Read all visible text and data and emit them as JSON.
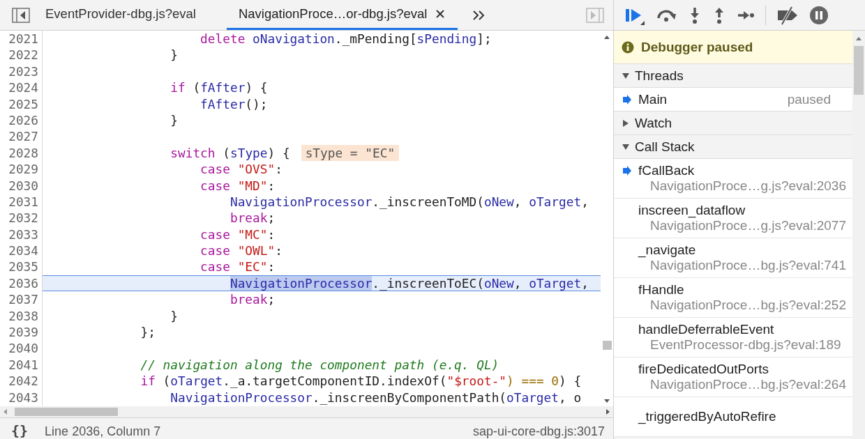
{
  "tabs": [
    {
      "label": "EventProvider-dbg.js?eval",
      "selected": false,
      "closable": false
    },
    {
      "label": "NavigationProce…or-dbg.js?eval",
      "selected": true,
      "closable": true
    }
  ],
  "code": {
    "lines": [
      {
        "number": "2021",
        "current": false,
        "tokens": [
          {
            "kind": "keyword",
            "text": "                    delete"
          },
          {
            "kind": "variable",
            "text": " oNavigation"
          },
          {
            "kind": "plain",
            "text": "._mPending["
          },
          {
            "kind": "variable",
            "text": "sPending"
          },
          {
            "kind": "plain",
            "text": "];"
          }
        ]
      },
      {
        "number": "2022",
        "current": false,
        "tokens": [
          {
            "kind": "plain",
            "text": "                }"
          }
        ]
      },
      {
        "number": "2023",
        "current": false
      },
      {
        "number": "2024",
        "current": false,
        "tokens": [
          {
            "kind": "keyword",
            "text": "                if"
          },
          {
            "kind": "plain",
            "text": " ("
          },
          {
            "kind": "variable",
            "text": "fAfter"
          },
          {
            "kind": "plain",
            "text": ") {"
          }
        ]
      },
      {
        "number": "2025",
        "current": false,
        "tokens": [
          {
            "kind": "variable",
            "text": "                    fAfter"
          },
          {
            "kind": "plain",
            "text": "();"
          }
        ]
      },
      {
        "number": "2026",
        "current": false,
        "tokens": [
          {
            "kind": "plain",
            "text": "                }"
          }
        ]
      },
      {
        "number": "2027",
        "current": false
      },
      {
        "number": "2028",
        "current": false,
        "tokens": [
          {
            "kind": "keyword",
            "text": "                switch"
          },
          {
            "kind": "plain",
            "text": " ("
          },
          {
            "kind": "variable",
            "text": "sType"
          },
          {
            "kind": "plain",
            "text": ") {"
          }
        ],
        "inline_value": "sType = \"EC\""
      },
      {
        "number": "2029",
        "current": false,
        "tokens": [
          {
            "kind": "keyword",
            "text": "                    case"
          },
          {
            "kind": "string",
            "text": " \"OVS\""
          },
          {
            "kind": "plain",
            "text": ":"
          }
        ]
      },
      {
        "number": "2030",
        "current": false,
        "tokens": [
          {
            "kind": "keyword",
            "text": "                    case"
          },
          {
            "kind": "string",
            "text": " \"MD\""
          },
          {
            "kind": "plain",
            "text": ":"
          }
        ]
      },
      {
        "number": "2031",
        "current": false,
        "tokens": [
          {
            "kind": "variable",
            "text": "                        NavigationProcessor"
          },
          {
            "kind": "plain",
            "text": "._inscreenToMD("
          },
          {
            "kind": "variable",
            "text": "oNew"
          },
          {
            "kind": "plain",
            "text": ", "
          },
          {
            "kind": "variable",
            "text": "oTarget"
          },
          {
            "kind": "plain",
            "text": ","
          }
        ]
      },
      {
        "number": "2032",
        "current": false,
        "tokens": [
          {
            "kind": "keyword",
            "text": "                        break"
          },
          {
            "kind": "plain",
            "text": ";"
          }
        ]
      },
      {
        "number": "2033",
        "current": false,
        "tokens": [
          {
            "kind": "keyword",
            "text": "                    case"
          },
          {
            "kind": "string",
            "text": " \"MC\""
          },
          {
            "kind": "plain",
            "text": ":"
          }
        ]
      },
      {
        "number": "2034",
        "current": false,
        "tokens": [
          {
            "kind": "keyword",
            "text": "                    case"
          },
          {
            "kind": "string",
            "text": " \"OWL\""
          },
          {
            "kind": "plain",
            "text": ":"
          }
        ]
      },
      {
        "number": "2035",
        "current": false,
        "tokens": [
          {
            "kind": "keyword",
            "text": "                    case"
          },
          {
            "kind": "string",
            "text": " \"EC\""
          },
          {
            "kind": "plain",
            "text": ":"
          }
        ]
      },
      {
        "number": "2036",
        "current": true,
        "tokens": [
          {
            "kind": "variable",
            "text": "                        NavigationProcessor",
            "selected": true
          },
          {
            "kind": "plain",
            "text": "._inscreenToEC("
          },
          {
            "kind": "variable",
            "text": "oNew"
          },
          {
            "kind": "plain",
            "text": ", "
          },
          {
            "kind": "variable",
            "text": "oTarget"
          },
          {
            "kind": "plain",
            "text": ","
          }
        ]
      },
      {
        "number": "2037",
        "current": false,
        "tokens": [
          {
            "kind": "keyword",
            "text": "                        break"
          },
          {
            "kind": "plain",
            "text": ";"
          }
        ]
      },
      {
        "number": "2038",
        "current": false,
        "tokens": [
          {
            "kind": "plain",
            "text": "                }"
          }
        ]
      },
      {
        "number": "2039",
        "current": false,
        "tokens": [
          {
            "kind": "plain",
            "text": "            };"
          }
        ]
      },
      {
        "number": "2040",
        "current": false
      },
      {
        "number": "2041",
        "current": false,
        "tokens": [
          {
            "kind": "comment",
            "text": "            // navigation along the component path (e.q. QL)"
          }
        ]
      },
      {
        "number": "2042",
        "current": false,
        "tokens": [
          {
            "kind": "keyword",
            "text": "            if"
          },
          {
            "kind": "plain",
            "text": " ("
          },
          {
            "kind": "variable",
            "text": "oTarget"
          },
          {
            "kind": "plain",
            "text": "._a.targetComponentID.indexOf("
          },
          {
            "kind": "string",
            "text": "\"$root-\""
          },
          {
            "kind": "operator",
            "text": ") ==="
          },
          {
            "kind": "number",
            "text": " 0"
          },
          {
            "kind": "plain",
            "text": ") {"
          }
        ]
      },
      {
        "number": "2043",
        "current": false,
        "tokens": [
          {
            "kind": "variable",
            "text": "                NavigationProcessor"
          },
          {
            "kind": "plain",
            "text": "._inscreenByComponentPath("
          },
          {
            "kind": "variable",
            "text": "oTarget"
          },
          {
            "kind": "plain",
            "text": ", o"
          }
        ]
      }
    ]
  },
  "status_bar": {
    "format_button": "{}",
    "position": "Line 2036, Column 7",
    "source": "sap-ui-core-dbg.js:3017"
  },
  "debugger": {
    "banner": "Debugger paused",
    "sections": [
      {
        "kind": "threads",
        "title": "Threads",
        "expanded": true,
        "threads": [
          {
            "name": "Main",
            "status": "paused",
            "current": true
          }
        ]
      },
      {
        "kind": "watch",
        "title": "Watch",
        "expanded": false
      },
      {
        "kind": "call_stack",
        "title": "Call Stack",
        "expanded": true,
        "frames": [
          {
            "function": "fCallBack",
            "location": "NavigationProce…g.js?eval:2036",
            "current": true
          },
          {
            "function": "inscreen_dataflow",
            "location": "NavigationProce…g.js?eval:2077",
            "current": false
          },
          {
            "function": "_navigate",
            "location": "NavigationProce…bg.js?eval:741",
            "current": false
          },
          {
            "function": "fHandle",
            "location": "NavigationProce…bg.js?eval:252",
            "current": false
          },
          {
            "function": "handleDeferrableEvent",
            "location": "EventProcessor-dbg.js?eval:189",
            "current": false
          },
          {
            "function": "fireDedicatedOutPorts",
            "location": "NavigationProce…bg.js?eval:264",
            "current": false
          },
          {
            "function": "_triggeredByAutoRefire",
            "current": false
          }
        ]
      }
    ]
  }
}
